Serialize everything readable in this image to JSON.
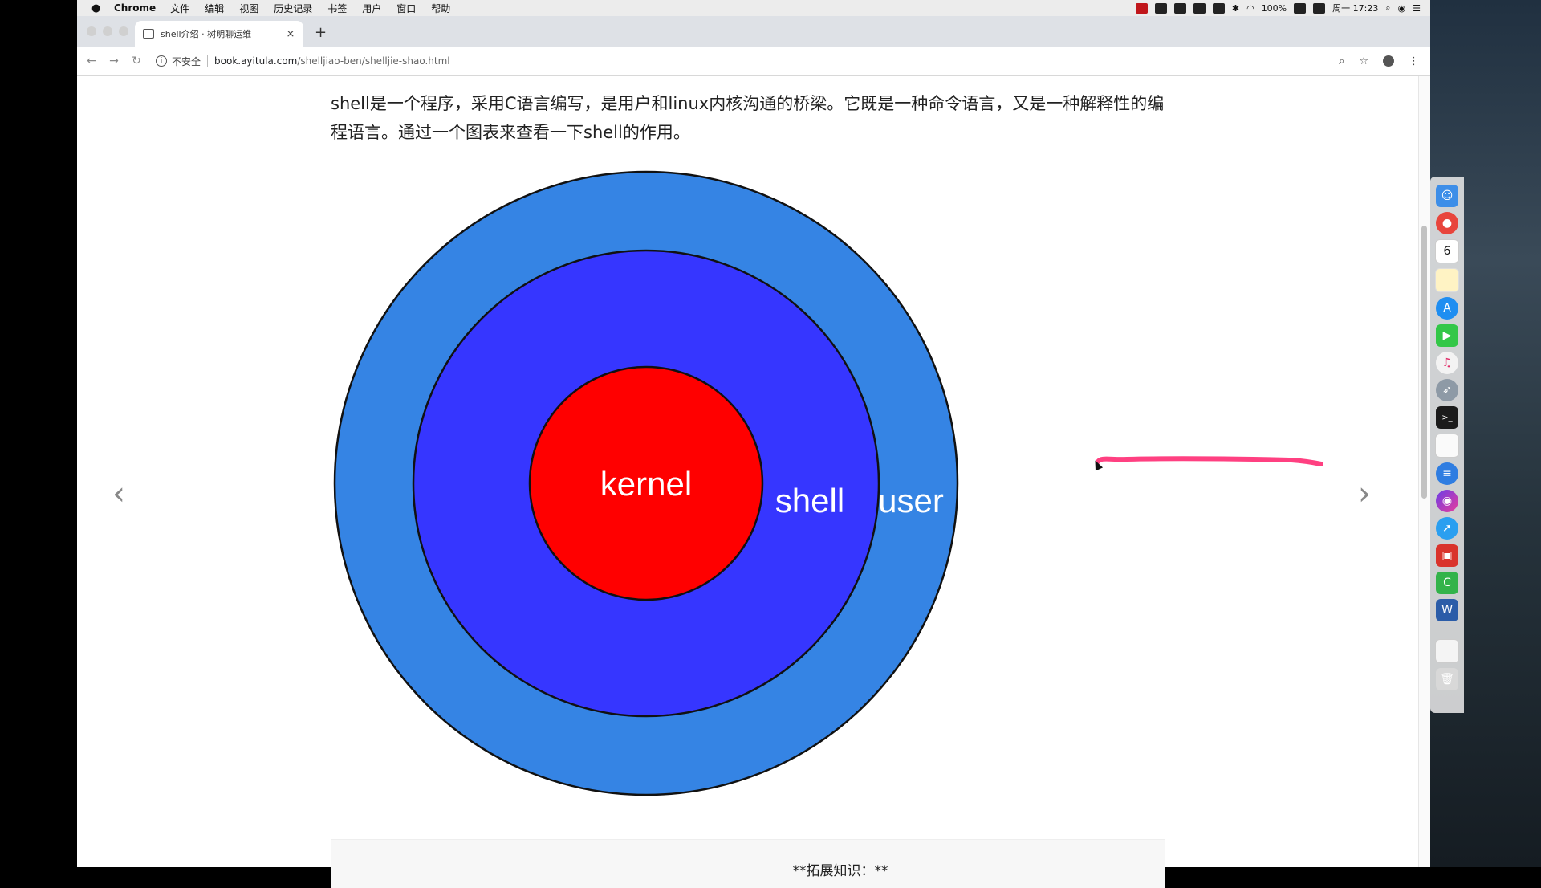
{
  "menubar": {
    "apple_icon": "apple-logo-icon",
    "app_name": "Chrome",
    "items": [
      "文件",
      "编辑",
      "视图",
      "历史记录",
      "书签",
      "用户",
      "窗口",
      "帮助"
    ],
    "battery": "100%",
    "clock": "周一 17:23"
  },
  "tab": {
    "title": "shell介绍 · 树明聊运维",
    "close": "×",
    "new_tab": "+"
  },
  "toolbar": {
    "back": "←",
    "forward": "→",
    "reload": "↻",
    "security_label": "不安全",
    "url_host": "book.ayitula.com",
    "url_path": "/shelljiao-ben/shelljie-shao.html",
    "zoom_icon": "zoom-icon",
    "star": "☆",
    "menu": "⋮"
  },
  "content": {
    "paragraph": "shell是一个程序，采用C语言编写，是用户和linux内核沟通的桥梁。它既是一种命令语言，又是一种解释性的编程语言。通过一个图表来查看一下shell的作用。",
    "prev_arrow": "‹",
    "next_arrow": "›",
    "tip": "**拓展知识：**"
  },
  "diagram": {
    "outer_label": "user",
    "middle_label": "shell",
    "inner_label": "kernel",
    "colors": {
      "outer": "#3584e4",
      "middle": "#3636ff",
      "inner": "#ff0000",
      "annotation": "#ff4081"
    }
  },
  "dock": {
    "icons": [
      "finder-icon",
      "chrome-icon",
      "calendar-icon",
      "notes-icon",
      "app-store-icon",
      "facetime-icon",
      "itunes-icon",
      "launchpad-icon",
      "terminal-icon",
      "textedit-icon",
      "stack-icon",
      "siri-icon",
      "safari-icon",
      "parallels-icon",
      "camtasia-icon",
      "word-icon",
      "documents-icon",
      "trash-icon"
    ],
    "calendar_day": "6"
  }
}
